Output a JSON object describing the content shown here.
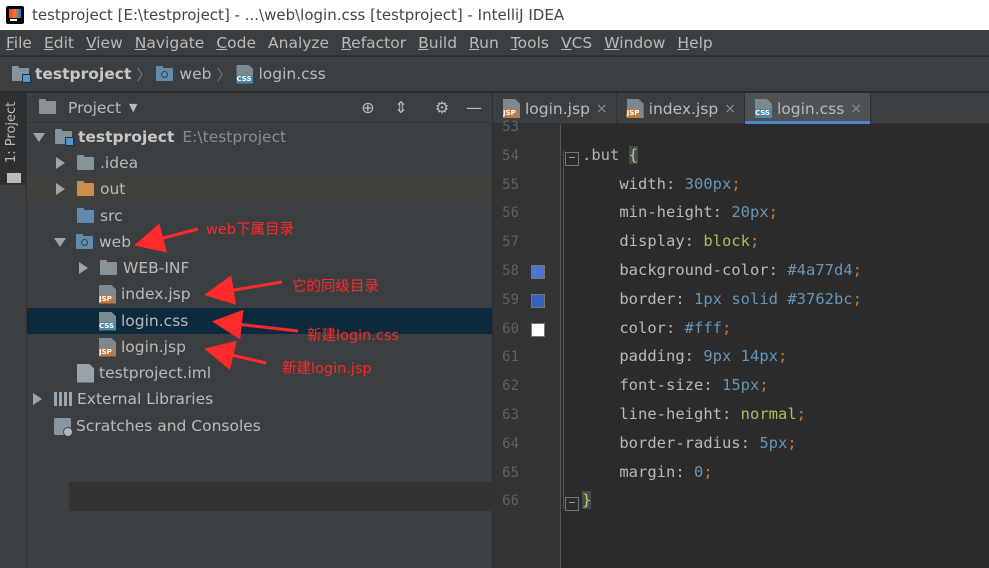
{
  "window": {
    "title": "testproject [E:\\testproject] - ...\\web\\login.css [testproject] - IntelliJ IDEA"
  },
  "menu": [
    {
      "u": "F",
      "rest": "ile"
    },
    {
      "u": "E",
      "rest": "dit"
    },
    {
      "u": "V",
      "rest": "iew"
    },
    {
      "u": "N",
      "rest": "avigate"
    },
    {
      "u": "C",
      "rest": "ode"
    },
    {
      "u": "",
      "rest": "Analyze"
    },
    {
      "u": "R",
      "rest": "efactor"
    },
    {
      "u": "B",
      "rest": "uild"
    },
    {
      "u": "R",
      "rest": "un"
    },
    {
      "u": "T",
      "rest": "ools"
    },
    {
      "u": "V",
      "rest": "CS"
    },
    {
      "u": "W",
      "rest": "indow"
    },
    {
      "u": "H",
      "rest": "elp"
    }
  ],
  "breadcrumb": {
    "project": "testproject",
    "folder": "web",
    "file": "login.css"
  },
  "left_stripe": {
    "tab_label": "1: Project"
  },
  "project_panel": {
    "title": "Project",
    "tree": {
      "root": "testproject",
      "root_path": "E:\\testproject",
      "idea": ".idea",
      "out": "out",
      "src": "src",
      "web": "web",
      "webinf": "WEB-INF",
      "index_jsp": "index.jsp",
      "login_css": "login.css",
      "login_jsp": "login.jsp",
      "iml": "testproject.iml",
      "ext_libs": "External Libraries",
      "scratches": "Scratches and Consoles"
    }
  },
  "annotations": {
    "web": "web下属目录",
    "index": "它的同级目录",
    "login_css": "新建login.css",
    "login_jsp": "新建login.jsp"
  },
  "icon_badges": {
    "jsp": "JSP",
    "css": "CSS"
  },
  "editor": {
    "tabs": [
      {
        "label": "login.jsp",
        "type": "jsp",
        "active": false
      },
      {
        "label": "index.jsp",
        "type": "jsp",
        "active": false
      },
      {
        "label": "login.css",
        "type": "css",
        "active": true
      }
    ],
    "line_numbers": [
      "53",
      "54",
      "55",
      "56",
      "57",
      "58",
      "59",
      "60",
      "61",
      "62",
      "63",
      "64",
      "65",
      "66"
    ],
    "selector": ".but",
    "open_brace": "{",
    "close_brace": "}",
    "lines": [
      {
        "prop": "width",
        "value": "300px"
      },
      {
        "prop": "min-height",
        "value": "20px"
      },
      {
        "prop": "display",
        "value": "block"
      },
      {
        "prop": "background-color",
        "value": "#4a77d4"
      },
      {
        "prop": "border",
        "value": "1px solid #3762bc"
      },
      {
        "prop": "color",
        "value": "#fff"
      },
      {
        "prop": "padding",
        "value": "9px 14px"
      },
      {
        "prop": "font-size",
        "value": "15px"
      },
      {
        "prop": "line-height",
        "value": "normal"
      },
      {
        "prop": "border-radius",
        "value": "5px"
      },
      {
        "prop": "margin",
        "value": "0"
      }
    ],
    "swatches": [
      "#4a77d4",
      "#3762bc",
      "#ffffff"
    ]
  }
}
